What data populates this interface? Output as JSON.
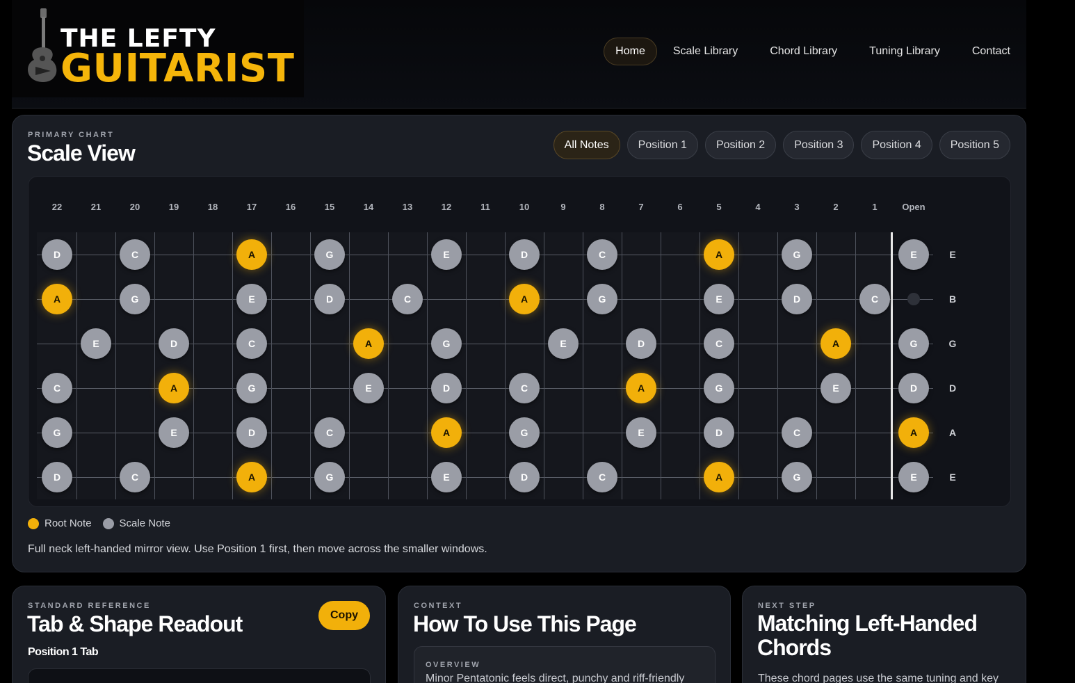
{
  "brand": {
    "line1": "THE LEFTY",
    "line2": "GUITARIST",
    "accent_color": "#f5b50a"
  },
  "nav": {
    "items": [
      {
        "label": "Home",
        "active": true
      },
      {
        "label": "Scale Library",
        "active": false
      },
      {
        "label": "Chord Library",
        "active": false
      },
      {
        "label": "Tuning Library",
        "active": false
      },
      {
        "label": "Contact",
        "active": false
      }
    ]
  },
  "scale_view": {
    "eyebrow": "PRIMARY CHART",
    "title": "Scale View",
    "tabs": [
      {
        "label": "All Notes",
        "active": true
      },
      {
        "label": "Position 1",
        "active": false
      },
      {
        "label": "Position 2",
        "active": false
      },
      {
        "label": "Position 3",
        "active": false
      },
      {
        "label": "Position 4",
        "active": false
      },
      {
        "label": "Position 5",
        "active": false
      }
    ],
    "fret_labels": [
      "22",
      "21",
      "20",
      "19",
      "18",
      "17",
      "16",
      "15",
      "14",
      "13",
      "12",
      "11",
      "10",
      "9",
      "8",
      "7",
      "6",
      "5",
      "4",
      "3",
      "2",
      "1",
      "Open"
    ],
    "strings": [
      "E",
      "B",
      "G",
      "D",
      "A",
      "E"
    ],
    "notes": [
      [
        [
          "22",
          "D"
        ],
        [
          "20",
          "C"
        ],
        [
          "17",
          "A"
        ],
        [
          "15",
          "G"
        ],
        [
          "12",
          "E"
        ],
        [
          "10",
          "D"
        ],
        [
          "8",
          "C"
        ],
        [
          "5",
          "A"
        ],
        [
          "3",
          "G"
        ],
        [
          "Open",
          "E"
        ]
      ],
      [
        [
          "22",
          "A"
        ],
        [
          "20",
          "G"
        ],
        [
          "17",
          "E"
        ],
        [
          "15",
          "D"
        ],
        [
          "13",
          "C"
        ],
        [
          "10",
          "A"
        ],
        [
          "8",
          "G"
        ],
        [
          "5",
          "E"
        ],
        [
          "3",
          "D"
        ],
        [
          "1",
          "C"
        ]
      ],
      [
        [
          "21",
          "E"
        ],
        [
          "19",
          "D"
        ],
        [
          "17",
          "C"
        ],
        [
          "14",
          "A"
        ],
        [
          "12",
          "G"
        ],
        [
          "9",
          "E"
        ],
        [
          "7",
          "D"
        ],
        [
          "5",
          "C"
        ],
        [
          "2",
          "A"
        ],
        [
          "Open",
          "G"
        ]
      ],
      [
        [
          "22",
          "C"
        ],
        [
          "19",
          "A"
        ],
        [
          "17",
          "G"
        ],
        [
          "14",
          "E"
        ],
        [
          "12",
          "D"
        ],
        [
          "10",
          "C"
        ],
        [
          "7",
          "A"
        ],
        [
          "5",
          "G"
        ],
        [
          "2",
          "E"
        ],
        [
          "Open",
          "D"
        ]
      ],
      [
        [
          "22",
          "G"
        ],
        [
          "19",
          "E"
        ],
        [
          "17",
          "D"
        ],
        [
          "15",
          "C"
        ],
        [
          "12",
          "A"
        ],
        [
          "10",
          "G"
        ],
        [
          "7",
          "E"
        ],
        [
          "5",
          "D"
        ],
        [
          "3",
          "C"
        ],
        [
          "Open",
          "A"
        ]
      ],
      [
        [
          "22",
          "D"
        ],
        [
          "20",
          "C"
        ],
        [
          "17",
          "A"
        ],
        [
          "15",
          "G"
        ],
        [
          "12",
          "E"
        ],
        [
          "10",
          "D"
        ],
        [
          "8",
          "C"
        ],
        [
          "5",
          "A"
        ],
        [
          "3",
          "G"
        ],
        [
          "Open",
          "E"
        ]
      ]
    ],
    "root_note": "A",
    "legend": {
      "root": "Root Note",
      "scale": "Scale Note"
    },
    "description": "Full neck left-handed mirror view. Use Position 1 first, then move across the smaller windows."
  },
  "tab_readout": {
    "eyebrow": "STANDARD REFERENCE",
    "title": "Tab & Shape Readout",
    "copy_label": "Copy",
    "subtitle": "Position 1 Tab"
  },
  "how_to": {
    "eyebrow": "CONTEXT",
    "title": "How To Use This Page",
    "overview_eyebrow": "OVERVIEW",
    "overview_text": "Minor Pentatonic feels direct, punchy and riff-friendly"
  },
  "next_step": {
    "eyebrow": "NEXT STEP",
    "title": "Matching Left-Handed Chords",
    "text": "These chord pages use the same tuning and key"
  }
}
